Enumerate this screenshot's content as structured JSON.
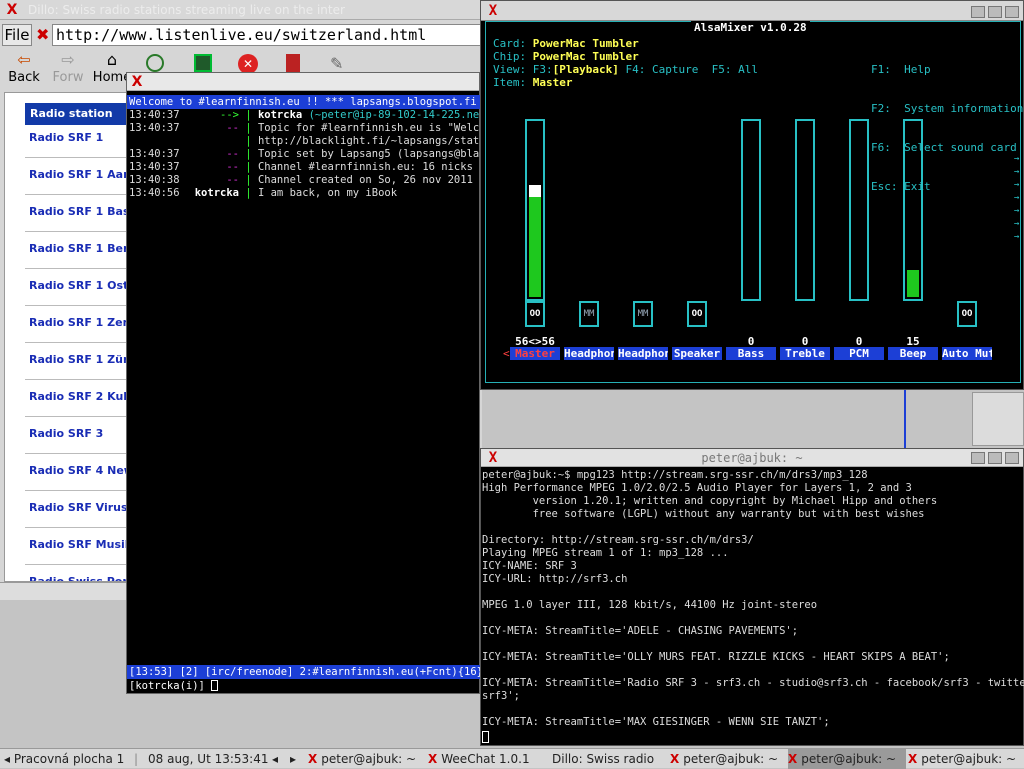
{
  "dillo": {
    "title": "Dillo: Swiss radio stations streaming live on the inter",
    "file_label": "File",
    "url": "http://www.listenlive.eu/switzerland.html",
    "nav": [
      {
        "label": "Back",
        "icon": "back-arrow-icon"
      },
      {
        "label": "Forw",
        "icon": "forward-arrow-icon"
      },
      {
        "label": "Home",
        "icon": "home-icon"
      }
    ],
    "station_header": "Radio station",
    "stations": [
      "Radio SRF 1",
      "Radio SRF 1 Aarg",
      "Radio SRF 1 Base",
      "Radio SRF 1 Bern",
      "Radio SRF 1 Ostsc",
      "Radio SRF 1 Zentr",
      "Radio SRF 1 Züric",
      "Radio SRF 2 Kultu",
      "Radio SRF 3",
      "Radio SRF 4 News",
      "Radio SRF Virus",
      "Radio SRF Musikw",
      "Radio Swiss Pop"
    ]
  },
  "weechat": {
    "topic_bar": "Welcome to #learnfinnish.eu  !! *** lapsangs.blogspot.fi **",
    "lines": [
      {
        "time": "13:40:37",
        "prefix": "-->",
        "nick": "kotrcka",
        "text": "(~peter@ip-89-102-14-225.net.upc"
      },
      {
        "time": "13:40:37",
        "prefix": "--",
        "nick": "",
        "text": "Topic for #learnfinnish.eu is \"Welcome"
      },
      {
        "time": "",
        "prefix": "",
        "nick": "",
        "text": "http://blacklight.fi/~lapsangs/stats/le"
      },
      {
        "time": "13:40:37",
        "prefix": "--",
        "nick": "",
        "text": "Topic set by Lapsang5 (lapsangs@blackli"
      },
      {
        "time": "13:40:37",
        "prefix": "--",
        "nick": "",
        "text": "Channel #learnfinnish.eu: 16 nicks (2 op"
      },
      {
        "time": "13:40:38",
        "prefix": "--",
        "nick": "",
        "text": "Channel created on So, 26 nov 2011 17:28"
      },
      {
        "time": "13:40:56",
        "prefix": "kotrcka",
        "nick": "",
        "text": "I am back, on my iBook"
      }
    ],
    "status_bar": "[13:53] [2] [irc/freenode] 2:#learnfinnish.eu(+Fcnt){16}",
    "input_prompt": "[kotrcka(i)]"
  },
  "alsa": {
    "title": "AlsaMixer v1.0.28",
    "card_label": "Card:",
    "card": "PowerMac Tumbler",
    "chip_label": "Chip:",
    "chip": "PowerMac Tumbler",
    "view_label": "View:",
    "view_f3": "F3:",
    "view_playback": "[Playback]",
    "view_f4": "F4: Capture",
    "view_f5": "F5: All",
    "item_label": "Item:",
    "item": "Master",
    "help": [
      {
        "key": "F1:",
        "text": "Help"
      },
      {
        "key": "F2:",
        "text": "System information"
      },
      {
        "key": "F6:",
        "text": "Select sound card"
      },
      {
        "key": "Esc:",
        "text": "Exit"
      }
    ],
    "channels": [
      {
        "name": "Master",
        "value": "56<>56",
        "level": 0.56,
        "switch": "OO",
        "has_bar": true
      },
      {
        "name": "Headphon",
        "value": "",
        "level": 0,
        "switch": "MM",
        "has_bar": false
      },
      {
        "name": "Headphon",
        "value": "",
        "level": 0,
        "switch": "MM",
        "has_bar": false
      },
      {
        "name": "Speaker",
        "value": "",
        "level": 0,
        "switch": "OO",
        "has_bar": false
      },
      {
        "name": "Bass",
        "value": "0",
        "level": 0,
        "switch": "",
        "has_bar": true
      },
      {
        "name": "Treble",
        "value": "0",
        "level": 0,
        "switch": "",
        "has_bar": true
      },
      {
        "name": "PCM",
        "value": "0",
        "level": 0,
        "switch": "",
        "has_bar": true
      },
      {
        "name": "Beep",
        "value": "15",
        "level": 0.15,
        "switch": "",
        "has_bar": true
      },
      {
        "name": "Auto Mut",
        "value": "",
        "level": 0,
        "switch": "OO",
        "has_bar": false
      }
    ]
  },
  "mpg": {
    "title": "peter@ajbuk: ~",
    "lines": [
      "peter@ajbuk:~$ mpg123 http://stream.srg-ssr.ch/m/drs3/mp3_128",
      "High Performance MPEG 1.0/2.0/2.5 Audio Player for Layers 1, 2 and 3",
      "        version 1.20.1; written and copyright by Michael Hipp and others",
      "        free software (LGPL) without any warranty but with best wishes",
      "",
      "Directory: http://stream.srg-ssr.ch/m/drs3/",
      "Playing MPEG stream 1 of 1: mp3_128 ...",
      "ICY-NAME: SRF 3",
      "ICY-URL: http://srf3.ch",
      "",
      "MPEG 1.0 layer III, 128 kbit/s, 44100 Hz joint-stereo",
      "",
      "ICY-META: StreamTitle='ADELE - CHASING PAVEMENTS';",
      "",
      "ICY-META: StreamTitle='OLLY MURS FEAT. RIZZLE KICKS - HEART SKIPS A BEAT';",
      "",
      "ICY-META: StreamTitle='Radio SRF 3 - srf3.ch - studio@srf3.ch - facebook/srf3 - twitter @",
      "srf3';",
      "",
      "ICY-META: StreamTitle='MAX GIESINGER - WENN SIE TANZT';"
    ]
  },
  "taskbar": {
    "workspace": "Pracovná plocha 1",
    "clock": "08 aug, Ut 13:53:41",
    "tasks": [
      "peter@ajbuk: ~",
      "WeeChat 1.0.1",
      "Dillo: Swiss radio",
      "peter@ajbuk: ~",
      "peter@ajbuk: ~",
      "peter@ajbuk: ~"
    ]
  }
}
